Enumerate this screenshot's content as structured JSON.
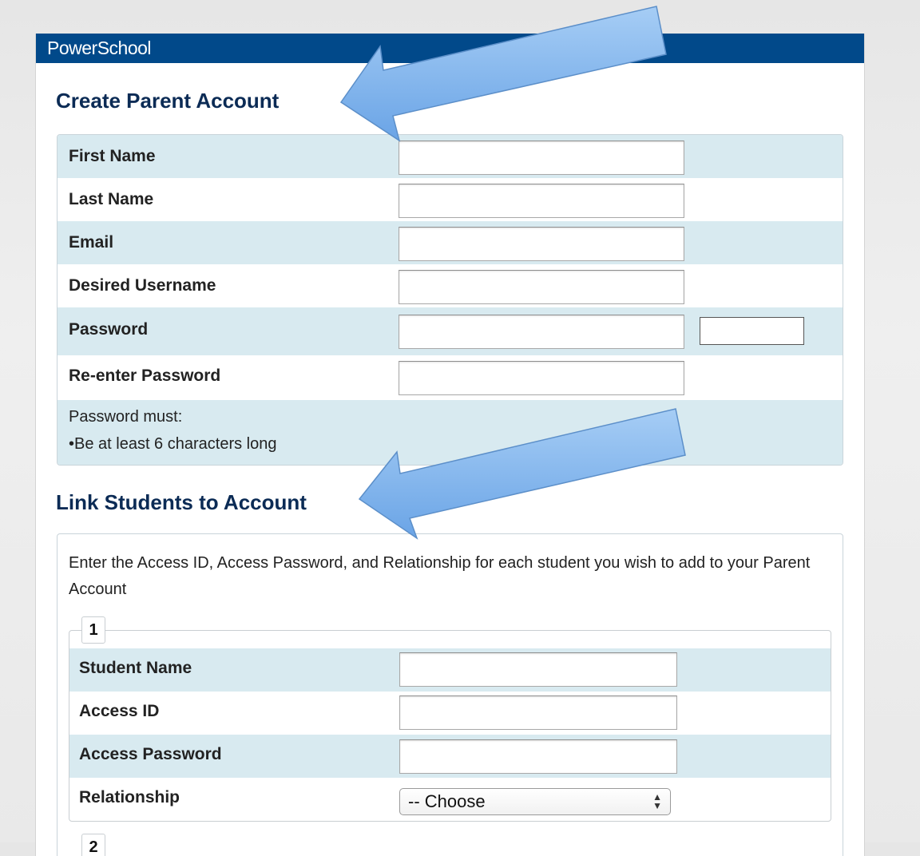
{
  "brand": "PowerSchool",
  "create_section": {
    "title": "Create Parent Account",
    "fields": [
      {
        "label": "First Name",
        "value": ""
      },
      {
        "label": "Last Name",
        "value": ""
      },
      {
        "label": "Email",
        "value": ""
      },
      {
        "label": "Desired Username",
        "value": ""
      },
      {
        "label": "Password",
        "value": ""
      },
      {
        "label": "Re-enter Password",
        "value": ""
      }
    ],
    "password_rules_title": "Password must:",
    "password_rules": [
      "•Be at least 6 characters long"
    ]
  },
  "link_section": {
    "title": "Link Students to Account",
    "instructions": "Enter the Access ID, Access Password, and Relationship for each student you wish to add to your Parent Account",
    "student_1": {
      "legend": "1",
      "fields": [
        {
          "label": "Student Name",
          "value": ""
        },
        {
          "label": "Access ID",
          "value": ""
        },
        {
          "label": "Access Password",
          "value": ""
        },
        {
          "label": "Relationship",
          "selected": "-- Choose"
        }
      ]
    },
    "student_2": {
      "legend": "2"
    }
  },
  "colors": {
    "brand_bar": "#01498a",
    "heading": "#0b2b55",
    "row_shade": "#d8eaf0",
    "annotation_arrow": "#7fb3ec"
  }
}
